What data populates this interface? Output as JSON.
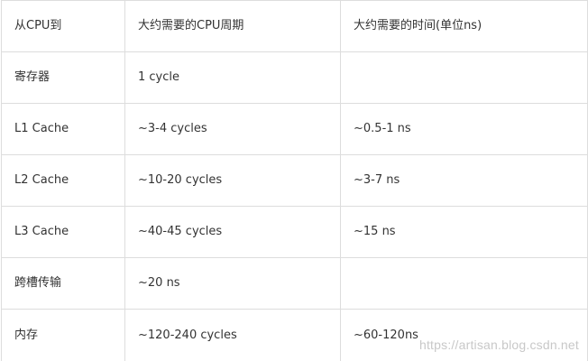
{
  "table": {
    "headers": [
      "从CPU到",
      "大约需要的CPU周期",
      "大约需要的时间(单位ns)"
    ],
    "rows": [
      [
        "寄存器",
        "1 cycle",
        ""
      ],
      [
        "L1 Cache",
        "~3-4 cycles",
        "~0.5-1 ns"
      ],
      [
        "L2 Cache",
        "~10-20 cycles",
        "~3-7 ns"
      ],
      [
        "L3 Cache",
        "~40-45 cycles",
        "~15 ns"
      ],
      [
        "跨槽传输",
        "~20 ns",
        ""
      ],
      [
        "内存",
        "~120-240 cycles",
        "~60-120ns"
      ]
    ]
  },
  "watermark": "https://artisan.blog.csdn.net"
}
